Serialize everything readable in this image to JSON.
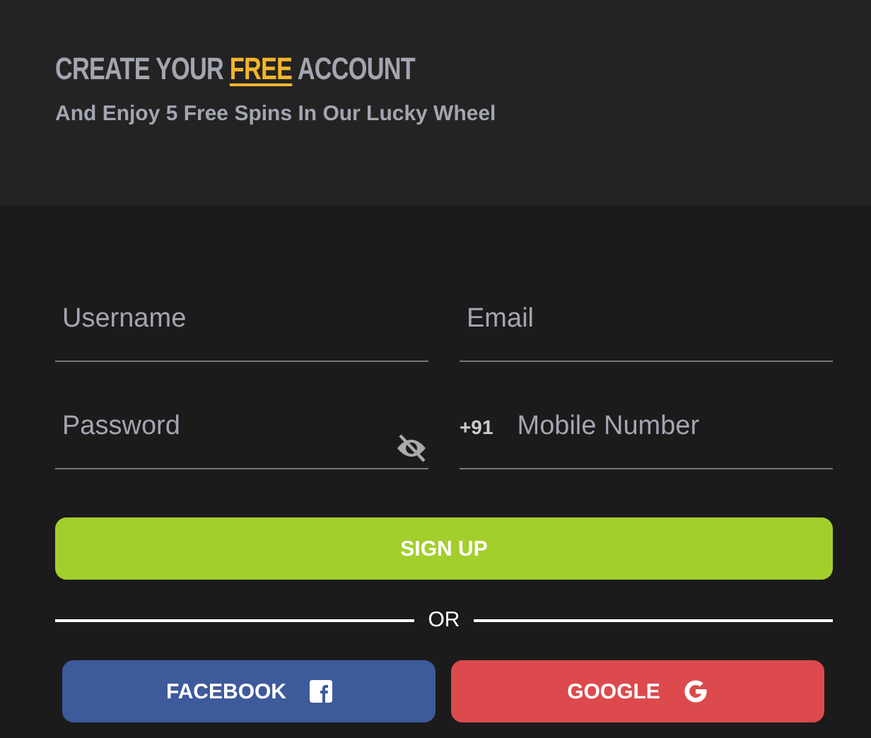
{
  "header": {
    "title": [
      {
        "text": "CREATE YOUR ",
        "highlight": false
      },
      {
        "text": "FREE",
        "highlight": true
      },
      {
        "text": " ACCOUNT",
        "highlight": false
      }
    ],
    "subtitle": "And Enjoy 5 Free Spins In Our Lucky Wheel"
  },
  "fields": [
    {
      "kind": "text",
      "placeholder": "Username"
    },
    {
      "kind": "text",
      "placeholder": "Email"
    },
    {
      "kind": "password",
      "placeholder": "Password"
    },
    {
      "kind": "phone",
      "prefix": "+91",
      "placeholder": "Mobile Number"
    }
  ],
  "submit": "SIGN UP",
  "divider": "OR",
  "social": [
    {
      "kind": "facebook",
      "label": "FACEBOOK"
    },
    {
      "kind": "google",
      "label": "GOOGLE"
    }
  ]
}
